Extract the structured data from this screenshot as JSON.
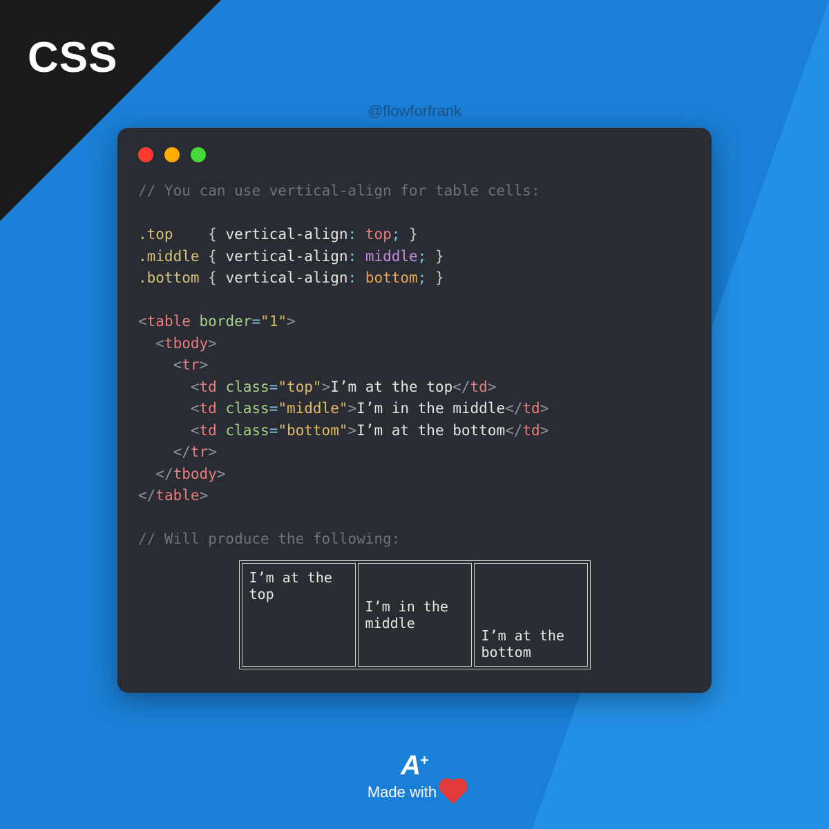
{
  "badge": "CSS",
  "handle": "@flowforfrank",
  "code": {
    "comment1": "// You can use vertical-align for table cells:",
    "sel_top": ".top",
    "sel_middle": ".middle",
    "sel_bottom": ".bottom",
    "prop": "vertical-align",
    "val_top": "top",
    "val_middle": "middle",
    "val_bottom": "bottom",
    "tag_table": "table",
    "attr_border": "border",
    "border_val": "\"1\"",
    "tag_tbody": "tbody",
    "tag_tr": "tr",
    "tag_td": "td",
    "attr_class": "class",
    "class_top": "\"top\"",
    "class_middle": "\"middle\"",
    "class_bottom": "\"bottom\"",
    "text_top": "I’m at the top",
    "text_middle": "I’m in the middle",
    "text_bottom": "I’m at the bottom",
    "comment2": "// Will produce the following:"
  },
  "demo": {
    "cell_top": "I’m at the top",
    "cell_middle": "I’m in the middle",
    "cell_bottom": "I’m at the bottom"
  },
  "footer": {
    "made": "Made with"
  }
}
